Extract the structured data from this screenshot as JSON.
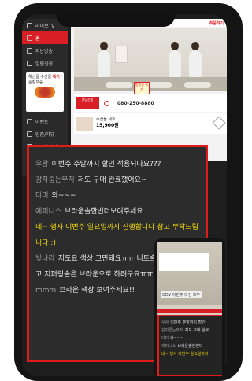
{
  "sidebar": {
    "items": [
      {
        "label": "라이브TV",
        "active": false
      },
      {
        "label": "홈",
        "active": true
      },
      {
        "label": "지난방송",
        "active": false
      },
      {
        "label": "알림신청",
        "active": false
      }
    ],
    "ad": {
      "line1": "해산물 수산물",
      "highlight": "특가",
      "line2": "품질보증"
    },
    "bottom_items": [
      {
        "label": "이벤트",
        "active": false
      },
      {
        "label": "인증/리뷰",
        "active": false
      },
      {
        "label": "마이페이지",
        "active": false
      }
    ]
  },
  "main": {
    "logo": "주문하기",
    "promo_tag": "방송중 특가",
    "cta_badge": "상담신청",
    "phone_number": "080-250-8880",
    "product_name": "수산물 세트",
    "product_price": "15,900원"
  },
  "comments": [
    {
      "nick": "우왕",
      "text": "이번주 주말까지 할인 적용되나요???",
      "host": false,
      "wrap": false
    },
    {
      "nick": "감자줍는무지",
      "text": "저도 구매 완료했어요~",
      "host": false,
      "wrap": false
    },
    {
      "nick": "다미",
      "text": "와~~~",
      "host": false,
      "wrap": false
    },
    {
      "nick": "에피니스",
      "text": "브라운솔한번더보여주세요",
      "host": false,
      "wrap": false
    },
    {
      "nick": "",
      "text": "네~ 행사 이번주 일요일까지 진행합니다 참고 부탁드립니다 :)",
      "host": true,
      "wrap": true
    },
    {
      "nick": "빛나라",
      "text": "저도요 색상 고민돼요ㅠㅠ 니트솔은 그레이로 하고 지퍼링솔은 브라운으로 하려구요ㅠㅠ",
      "host": false,
      "wrap": true
    },
    {
      "nick": "mmm",
      "text": "브라운 색상 보여주세요!!",
      "host": false,
      "wrap": false
    }
  ],
  "inset": {
    "label": "ODV 이번주 라인 모두",
    "comments": [
      {
        "nick": "우왕",
        "text": "이번주 주말까지 할인",
        "host": false
      },
      {
        "nick": "감자줍는무지",
        "text": "저도 구매 완료",
        "host": false
      },
      {
        "nick": "다미",
        "text": "와~~~",
        "host": false
      },
      {
        "nick": "에피니스",
        "text": "브라운솔한번더",
        "host": false
      },
      {
        "nick": "",
        "text": "네~ 행사 이번주 일요일까지",
        "host": true
      }
    ]
  }
}
